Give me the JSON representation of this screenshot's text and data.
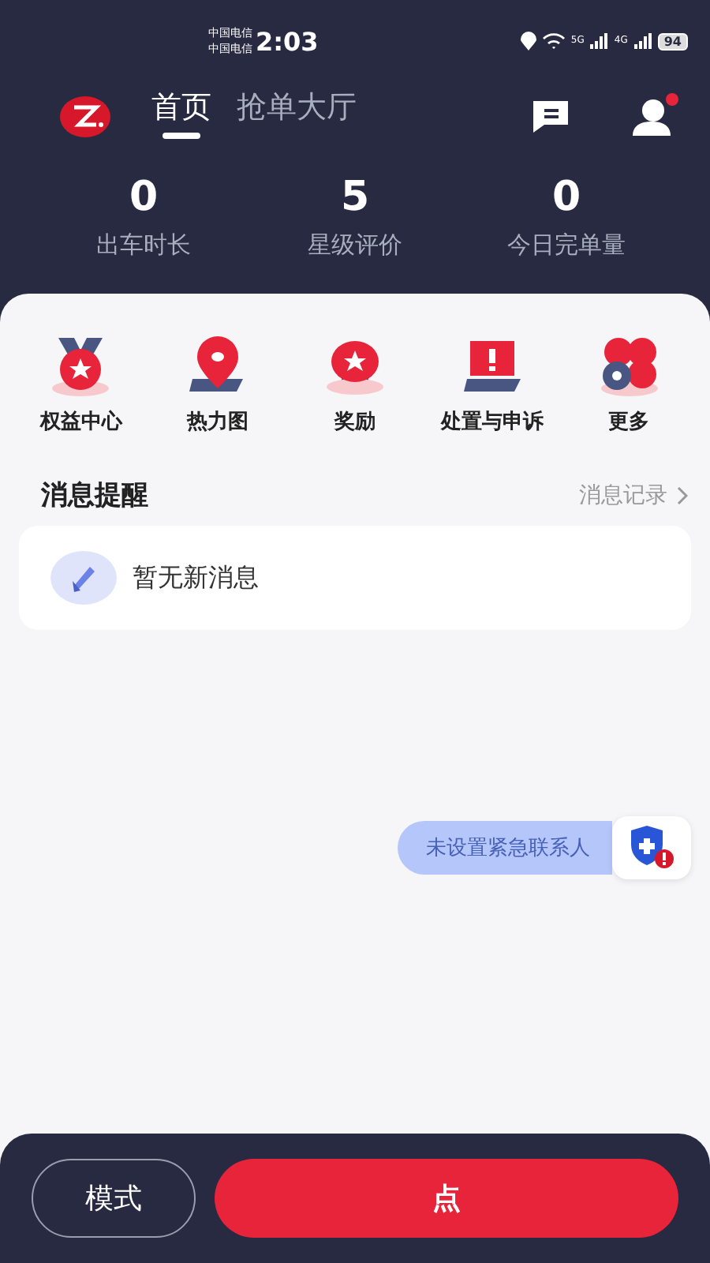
{
  "status_bar": {
    "carriers": [
      "中国电信",
      "中国电信"
    ],
    "time": "2:03",
    "networks": [
      "5G",
      "4G"
    ],
    "battery": "94"
  },
  "nav": {
    "tabs": [
      {
        "label": "首页",
        "selected": true
      },
      {
        "label": "抢单大厅",
        "selected": false
      }
    ],
    "profile_badge": true
  },
  "stats": [
    {
      "value": "0",
      "label": "出车时长"
    },
    {
      "value": "5",
      "label": "星级评价"
    },
    {
      "value": "0",
      "label": "今日完单量"
    }
  ],
  "shortcuts": [
    {
      "kind": "medal",
      "label": "权益中心"
    },
    {
      "kind": "pin",
      "label": "热力图"
    },
    {
      "kind": "star",
      "label": "奖励"
    },
    {
      "kind": "alert",
      "label": "处置与申诉"
    },
    {
      "kind": "more",
      "label": "更多"
    }
  ],
  "messages": {
    "title": "消息提醒",
    "link": "消息记录",
    "empty": "暂无新消息"
  },
  "emergency": {
    "label": "未设置紧急联系人"
  },
  "bottom": {
    "mode_button": "模式",
    "start_button": "点"
  }
}
